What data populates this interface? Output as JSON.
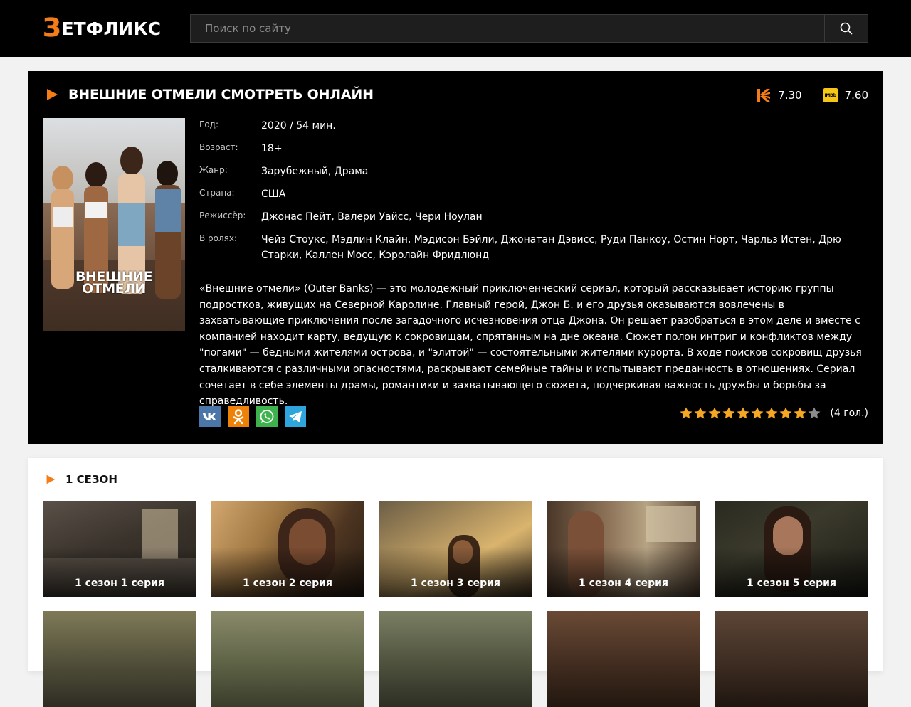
{
  "header": {
    "logo_first": "З",
    "logo_rest": "ЕТФЛИКС",
    "search_placeholder": "Поиск по сайту"
  },
  "film": {
    "title": "ВНЕШНИЕ ОТМЕЛИ СМОТРЕТЬ ОНЛАЙН",
    "poster_title_line1": "ВНЕШНИЕ",
    "poster_title_line2": "ОТМЕЛИ",
    "ratings": [
      {
        "source": "kinopoisk",
        "value": "7.30"
      },
      {
        "source": "imdb",
        "badge": "IMDb",
        "value": "7.60"
      }
    ],
    "meta": [
      {
        "label": "Год:",
        "value": "2020 / 54 мин."
      },
      {
        "label": "Возраст:",
        "value": "18+"
      },
      {
        "label": "Жанр:",
        "value": "Зарубежный, Драма"
      },
      {
        "label": "Страна:",
        "value": "США"
      },
      {
        "label": "Режиссёр:",
        "value": "Джонас Пейт, Валери Уайсс, Чери Ноулан"
      },
      {
        "label": "В ролях:",
        "value": "Чейз Стоукс, Мэдлин Клайн, Мэдисон Бэйли, Джонатан Дэвисс, Руди Панкоу, Остин Норт, Чарльз Истен, Дрю Старки, Каллен Мосс, Кэролайн Фридлюнд"
      }
    ],
    "description": "«Внешние отмели» (Outer Banks) — это молодежный приключенческий сериал, который рассказывает историю группы подростков, живущих на Северной Каролине. Главный герой, Джон Б. и его друзья оказываются вовлечены в захватывающие приключения после загадочного исчезновения отца Джона. Он решает разобраться в этом деле и вместе с компанией находит карту, ведущую к сокровищам, спрятанным на дне океана. Сюжет полон интриг и конфликтов между \"погами\" — бедными жителями острова, и \"элитой\" — состоятельными жителями курорта. В ходе поисков сокровищ друзья сталкиваются с различными опасностями, раскрывают семейные тайны и испытывают преданность в отношениях. Сериал сочетает в себе элементы драмы, романтики и захватывающего сюжета, подчеркивая важность дружбы и борьбы за справедливость.",
    "social": [
      {
        "name": "vk",
        "color": "#4a76a8"
      },
      {
        "name": "ok",
        "color": "#ee8208"
      },
      {
        "name": "whatsapp",
        "color": "#3eb34d"
      },
      {
        "name": "telegram",
        "color": "#2ea5dc"
      }
    ],
    "stars_total": 10,
    "stars_filled": 9,
    "star_color": "#f5a623",
    "votes": "(4 гол.)"
  },
  "season": {
    "title": "1 СЕЗОН",
    "episodes": [
      {
        "label": "1 сезон 1 серия"
      },
      {
        "label": "1 сезон 2 серия"
      },
      {
        "label": "1 сезон 3 серия"
      },
      {
        "label": "1 сезон 4 серия"
      },
      {
        "label": "1 сезон 5 серия"
      },
      {
        "label": ""
      },
      {
        "label": ""
      },
      {
        "label": ""
      },
      {
        "label": ""
      },
      {
        "label": ""
      }
    ]
  },
  "colors": {
    "accent": "#f57c16",
    "panel": "#000000",
    "page_bg": "#f2f2f2"
  }
}
